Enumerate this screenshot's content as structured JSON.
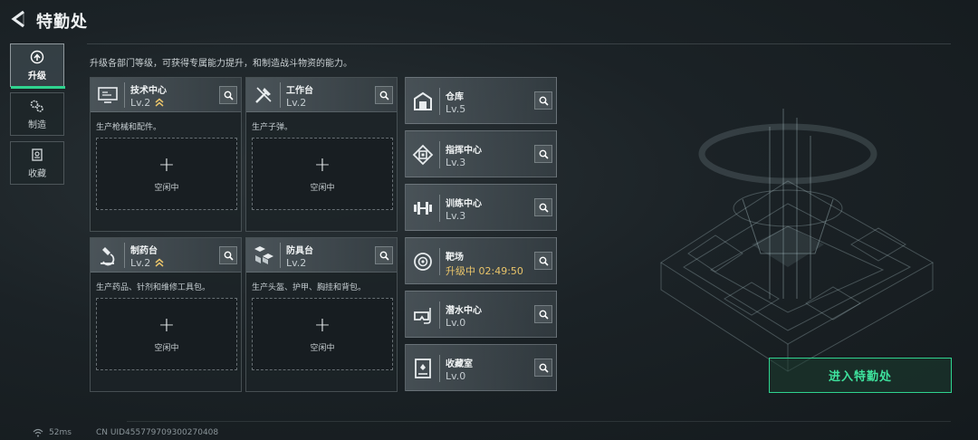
{
  "header": {
    "title": "特勤处"
  },
  "subtitle": "升级各部门等级，可获得专属能力提升，和制造战斗物资的能力。",
  "sidebar": {
    "items": [
      {
        "label": "升级",
        "icon": "upgrade-icon",
        "active": true
      },
      {
        "label": "制造",
        "icon": "gears-icon",
        "active": false
      },
      {
        "label": "收藏",
        "icon": "collection-icon",
        "active": false
      }
    ]
  },
  "departments": [
    {
      "name": "技术中心",
      "level": "Lv.2",
      "icon": "monitor-icon",
      "upgradable": true,
      "desc": "生产枪械和配件。",
      "slot_label": "空闲中"
    },
    {
      "name": "工作台",
      "level": "Lv.2",
      "icon": "tools-icon",
      "upgradable": false,
      "desc": "生产子弹。",
      "slot_label": "空闲中"
    },
    {
      "name": "制药台",
      "level": "Lv.2",
      "icon": "microscope-icon",
      "upgradable": true,
      "desc": "生产药品、针剂和维修工具包。",
      "slot_label": "空闲中"
    },
    {
      "name": "防具台",
      "level": "Lv.2",
      "icon": "boxes-icon",
      "upgradable": false,
      "desc": "生产头盔、护甲、胸挂和背包。",
      "slot_label": "空闲中"
    }
  ],
  "facilities": [
    {
      "name": "仓库",
      "level": "Lv.5",
      "icon": "warehouse-icon"
    },
    {
      "name": "指挥中心",
      "level": "Lv.3",
      "icon": "chip-icon"
    },
    {
      "name": "训练中心",
      "level": "Lv.3",
      "icon": "dumbbell-icon"
    },
    {
      "name": "靶场",
      "level": "升级中 02:49:50",
      "icon": "target-icon",
      "status": "upgrading"
    },
    {
      "name": "潜水中心",
      "level": "Lv.0",
      "icon": "diving-mask-icon"
    },
    {
      "name": "收藏室",
      "level": "Lv.0",
      "icon": "display-case-icon"
    }
  ],
  "enter_button": "进入特勤处",
  "footer": {
    "ping": "52ms",
    "uid": "CN UID455779709300270408"
  },
  "colors": {
    "accent": "#2fd38f",
    "upgrading": "#e9c46a",
    "upgrade_arrow": "#e9c46a"
  }
}
